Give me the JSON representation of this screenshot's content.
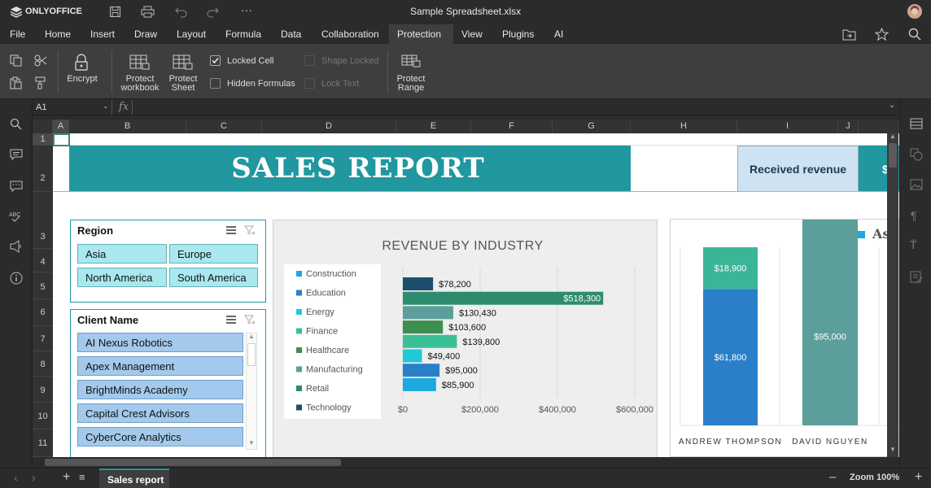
{
  "app": {
    "brand": "ONLYOFFICE",
    "file_title": "Sample Spreadsheet.xlsx"
  },
  "menu": {
    "tabs": [
      "File",
      "Home",
      "Insert",
      "Draw",
      "Layout",
      "Formula",
      "Data",
      "Collaboration",
      "Protection",
      "View",
      "Plugins",
      "AI"
    ],
    "active": "Protection"
  },
  "toolbar": {
    "encrypt": "Encrypt",
    "protect_workbook_1": "Protect",
    "protect_workbook_2": "workbook",
    "protect_sheet_1": "Protect",
    "protect_sheet_2": "Sheet",
    "locked_cell": "Locked Cell",
    "locked_cell_checked": true,
    "hidden_formulas": "Hidden Formulas",
    "shape_locked": "Shape Locked",
    "lock_text": "Lock Text",
    "protect_range_1": "Protect",
    "protect_range_2": "Range"
  },
  "formula_bar": {
    "cell_ref": "A1",
    "fx": "fx",
    "value": ""
  },
  "columns": [
    "A",
    "B",
    "C",
    "D",
    "E",
    "F",
    "G",
    "H",
    "I",
    "J"
  ],
  "rows": [
    "1",
    "2",
    "3",
    "4",
    "5",
    "6",
    "7",
    "8",
    "9",
    "10",
    "11"
  ],
  "sheet": {
    "title": "SALES REPORT",
    "received_revenue": "Received revenue",
    "truncated_cell": "$",
    "accent": "#21979f"
  },
  "region_slicer": {
    "title": "Region",
    "items": [
      "Asia",
      "Europe",
      "North America",
      "South America"
    ]
  },
  "client_slicer": {
    "title": "Client Name",
    "items": [
      "AI Nexus Robotics",
      "Apex Management",
      "BrightMinds Academy",
      "Capital Crest Advisors",
      "CyberCore Analytics"
    ]
  },
  "chart_data": [
    {
      "type": "bar",
      "orientation": "horizontal",
      "title": "REVENUE BY INDUSTRY",
      "categories": [
        "Construction",
        "Education",
        "Energy",
        "Finance",
        "Healthcare",
        "Manufacturing",
        "Retail",
        "Technology"
      ],
      "values": [
        85900,
        95000,
        49400,
        139800,
        103600,
        130430,
        518300,
        78200
      ],
      "data_labels": [
        "$85,900",
        "$95,000",
        "$49,400",
        "$139,800",
        "$103,600",
        "$130,430",
        "$518,300",
        "$78,200"
      ],
      "colors": [
        "#1ca9e0",
        "#2b7fc8",
        "#22c8d8",
        "#3bbf97",
        "#3d8f4f",
        "#5c9e9a",
        "#2e8c6e",
        "#1b4f6e"
      ],
      "xlim": [
        0,
        600000
      ],
      "xticks": [
        "$0",
        "$200,000",
        "$400,000",
        "$600,000"
      ],
      "legend_position": "left"
    },
    {
      "type": "bar",
      "stacked": true,
      "legend_partial": "As",
      "legend_color": "#1ca9e0",
      "categories": [
        "ANDREW THOMPSON",
        "DAVID NGUYEN"
      ],
      "series": [
        {
          "values": [
            61800,
            null
          ],
          "color": "#2b7fc8"
        },
        {
          "values": [
            18900,
            95000
          ],
          "color": "#3bb597"
        }
      ],
      "data_labels": [
        [
          "$61,800",
          "$18,900"
        ],
        [
          "$95,000"
        ]
      ]
    }
  ],
  "footer": {
    "sheet_tab": "Sales report",
    "zoom": "Zoom 100%"
  }
}
